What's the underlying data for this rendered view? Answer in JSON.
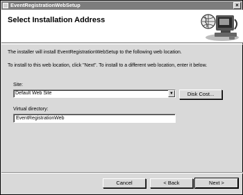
{
  "window": {
    "title": "EventRegistrationWebSetup",
    "close_glyph": "×"
  },
  "header": {
    "title": "Select Installation Address",
    "art_icon": "computer-globe-icon"
  },
  "body": {
    "line1": "The installer will install EventRegistrationWebSetup to the following web location.",
    "line2": "To install to this web location, click \"Next\". To install to a different web location, enter it below."
  },
  "site": {
    "label": "Site:",
    "selected": "Default Web Site",
    "arrow": "▼"
  },
  "disk_cost": {
    "label": "Disk Cost..."
  },
  "virtual_directory": {
    "label": "Virtual directory:",
    "value": "EventRegistrationWeb"
  },
  "footer": {
    "cancel": "Cancel",
    "back": "< Back",
    "next": "Next >"
  }
}
